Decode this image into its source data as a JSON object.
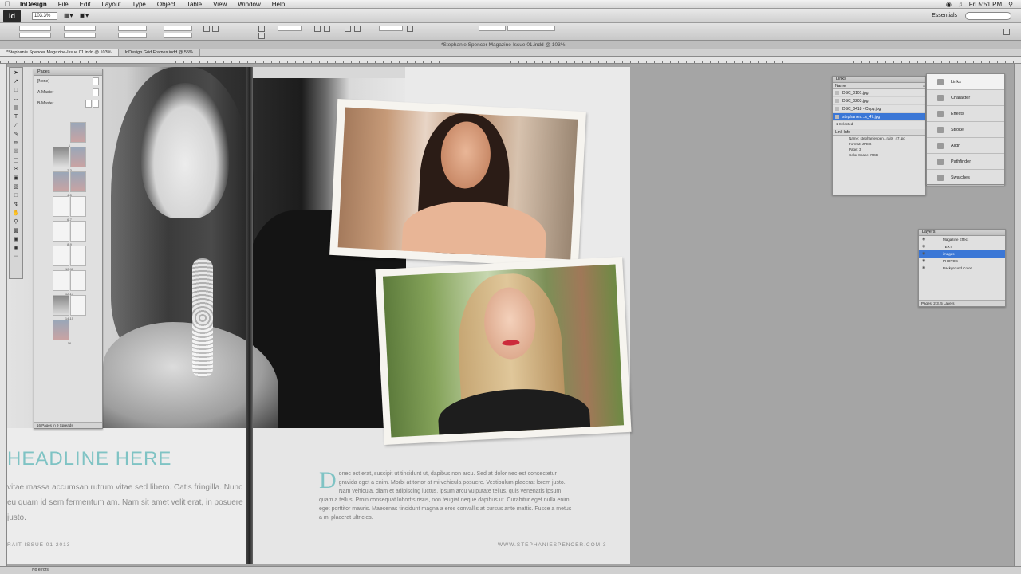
{
  "menubar": {
    "app": "InDesign",
    "items": [
      "File",
      "Edit",
      "Layout",
      "Type",
      "Object",
      "Table",
      "View",
      "Window",
      "Help"
    ],
    "clock": "Fri 5:51 PM"
  },
  "appbar": {
    "logo": "Id",
    "zoom": "103.3%",
    "workspace": "Essentials",
    "search_placeholder": ""
  },
  "document": {
    "window_title": "*Stephanie Spencer Magazine-Issue 01.indd @ 103%",
    "tabs": [
      "*Stephanie Spencer Magazine-Issue 01.indd @ 103%",
      "InDesign Grid Frames.indd @ 55%"
    ]
  },
  "spread": {
    "headline": "HEADLINE HERE",
    "body_left": "vitae massa accumsan rutrum vitae sed libero. Catis fringilla. Nunc eu quam id sem fermentum am. Nam sit amet velit erat, in posuere justo.",
    "folio_left": "RAIT ISSUE 01 2013",
    "dropcap": "D",
    "body_right": "onec est erat, suscipit ut tincidunt ut, dapibus non arcu. Sed at dolor nec est consectetur gravida eget a enim. Morbi at tortor at mi vehicula posuere. Vestibulum placerat lorem justo. Nam vehicula, diam et adipiscing luctus, ipsum arcu vulputate tellus, quis venenatis ipsum quam a tellus. Proin consequat lobortis risus, non feugiat neque dapibus ut. Curabitur eget nulla enim, eget porttitor mauris. Maecenas tincidunt magna a eros convallis at cursus ante mattis. Fusce a metus a mi placerat ultricies.",
    "folio_right": "WWW.STEPHANIESPENCER.COM  3"
  },
  "pages_panel": {
    "title": "Pages",
    "masters": [
      "[None]",
      "A-Master",
      "B-Master"
    ],
    "thumbs": [
      "1",
      "2-3",
      "4-5",
      "6-7",
      "8-9",
      "10-11",
      "12-13",
      "14-15",
      "16"
    ],
    "status": "16 Pages in 9 Spreads"
  },
  "links_panel": {
    "title": "Links",
    "column": "Name",
    "rows": [
      "DSC_0101.jpg",
      "DSC_0203.jpg",
      "DSC_0418 - Copy.jpg",
      "stephanies...s_47.jpg"
    ],
    "selected_count": "1 Selected",
    "info_title": "Link Info",
    "info": [
      "Name: stephaniespen...raits_47.jpg",
      "Format: JPEG",
      "Page: 3",
      "Color Space: RGB"
    ]
  },
  "dock": {
    "items": [
      "Links",
      "Character",
      "Effects",
      "Stroke",
      "Align",
      "Pathfinder",
      "Swatches"
    ]
  },
  "layers_panel": {
    "title": "Layers",
    "rows": [
      "Magazine Effect",
      "TEXT",
      "images",
      "PHOTOS",
      "Background Color"
    ],
    "status": "Pages: 2-3, 5 Layers"
  },
  "statusbar": {
    "text": "No errors"
  }
}
